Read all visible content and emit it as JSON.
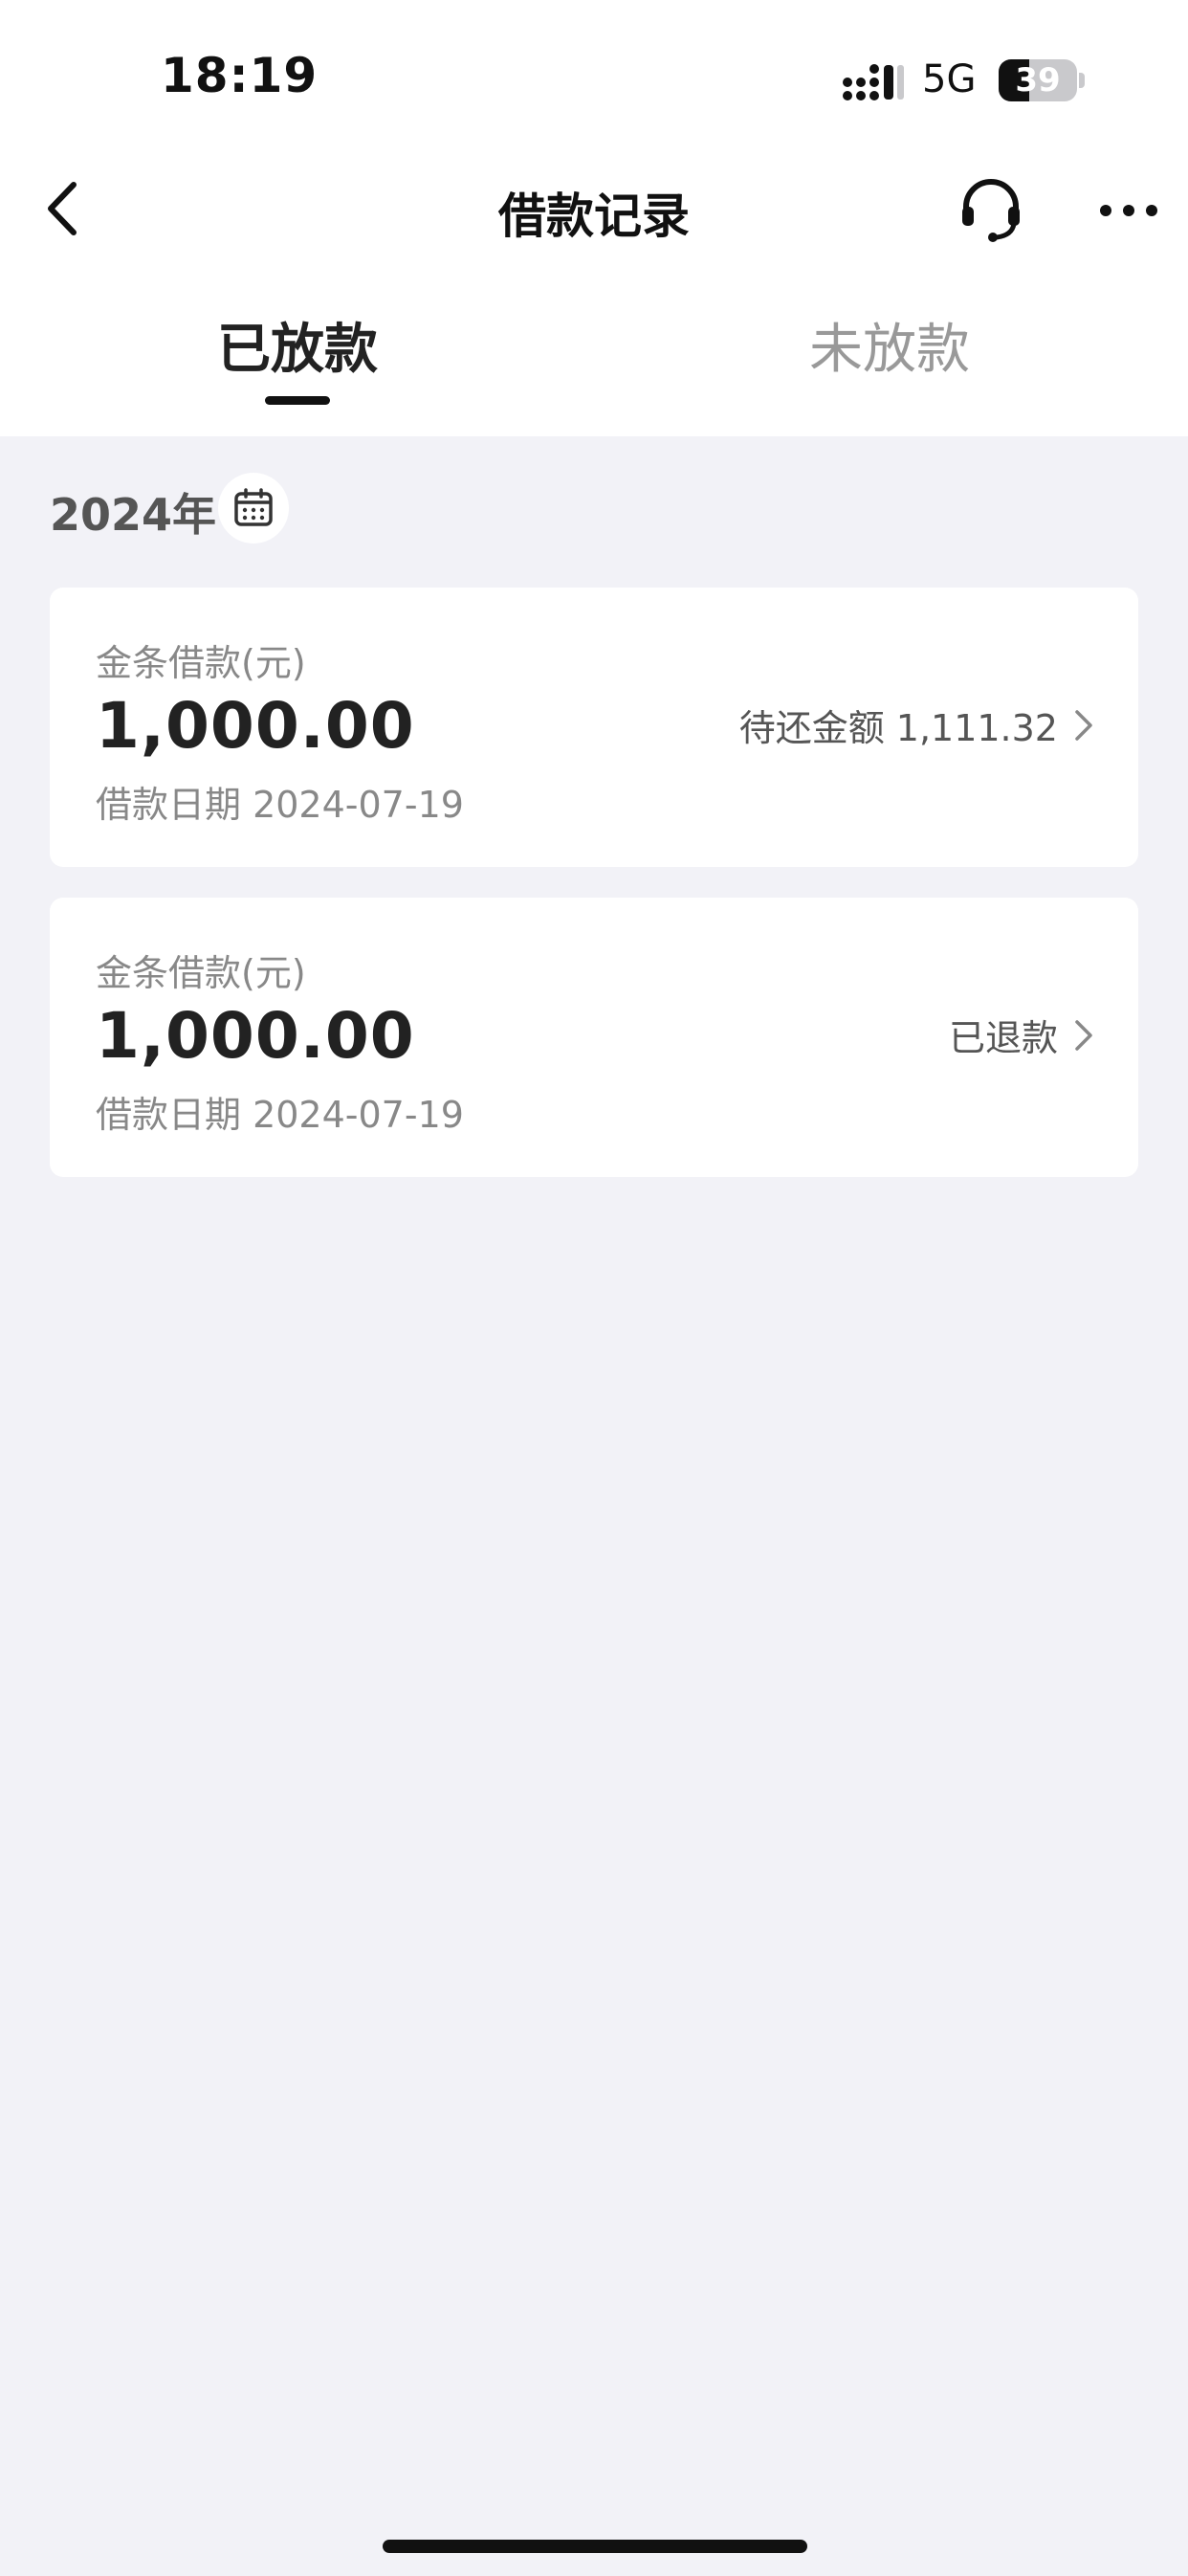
{
  "status_bar": {
    "time": "18:19",
    "network": "5G",
    "battery": "39",
    "battery_level": 0.39
  },
  "nav": {
    "title": "借款记录"
  },
  "tabs": [
    {
      "label": "已放款",
      "active": true
    },
    {
      "label": "未放款",
      "active": false
    }
  ],
  "filter": {
    "year": "2024年"
  },
  "loans": [
    {
      "label": "金条借款(元)",
      "amount": "1,000.00",
      "date": "借款日期 2024-07-19",
      "status": "待还金额 1,111.32"
    },
    {
      "label": "金条借款(元)",
      "amount": "1,000.00",
      "date": "借款日期 2024-07-19",
      "status": "已退款"
    }
  ],
  "icons": {
    "back": "chevron-left-icon",
    "support": "headset-icon",
    "more": "more-dots-icon",
    "calendar": "calendar-icon",
    "row_arrow": "chevron-right-icon"
  }
}
